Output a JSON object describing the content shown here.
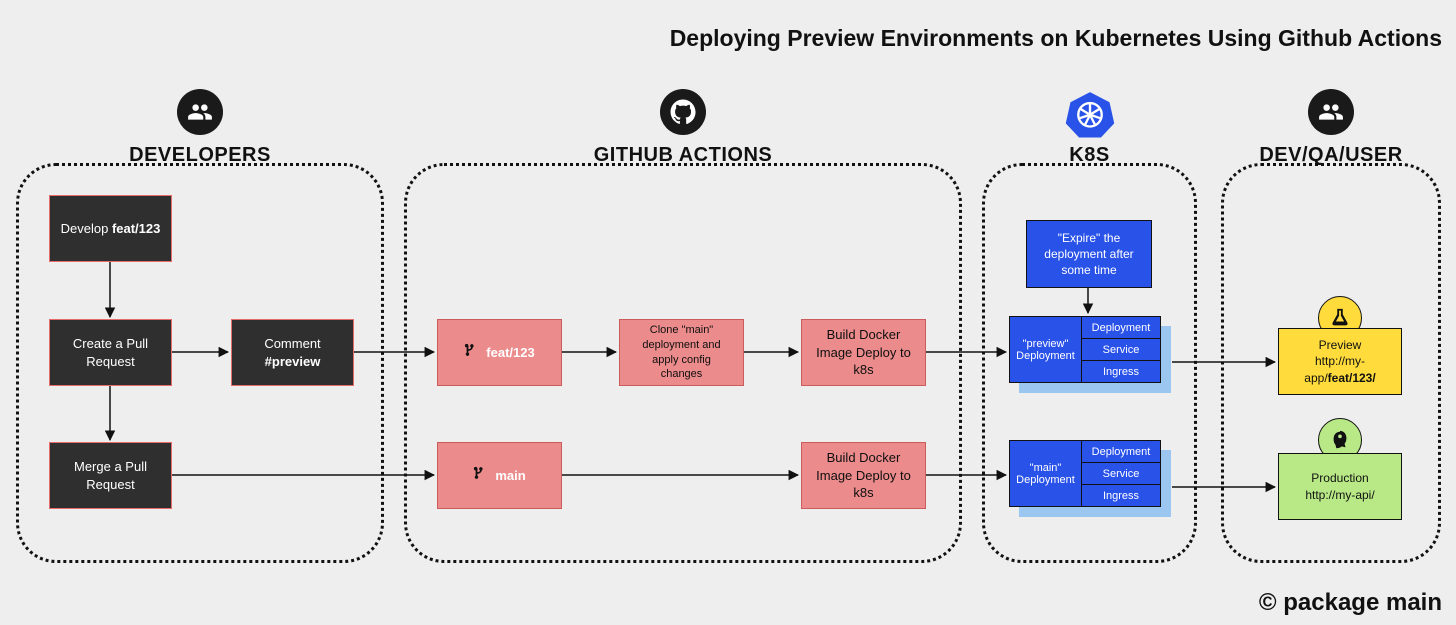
{
  "title": "Deploying Preview Environments on Kubernetes Using Github Actions",
  "copyright": "© package main",
  "groups": {
    "developers": {
      "label": "DEVELOPERS"
    },
    "github": {
      "label": "GITHUB ACTIONS"
    },
    "k8s": {
      "label": "K8S"
    },
    "user": {
      "label": "DEV/QA/USER"
    }
  },
  "dev": {
    "develop_pre": "Develop ",
    "develop_branch": "feat/123",
    "create_pr": "Create a Pull Request",
    "comment_pre": "Comment ",
    "comment_tag": "#preview",
    "merge_pr": "Merge a Pull Request"
  },
  "gha": {
    "branch_feat": "feat/123",
    "branch_main": "main",
    "clone": "Clone \"main\" deployment and apply config changes",
    "build_feat": "Build Docker Image Deploy to k8s",
    "build_main": "Build Docker Image Deploy to k8s"
  },
  "k8s": {
    "expire": "\"Expire\" the deployment after some time",
    "preview": {
      "label": "\"preview\" Deployment",
      "rows": [
        "Deployment",
        "Service",
        "Ingress"
      ]
    },
    "main": {
      "label": "\"main\" Deployment",
      "rows": [
        "Deployment",
        "Service",
        "Ingress"
      ]
    }
  },
  "env": {
    "preview": {
      "label": "Preview",
      "url_pre": "http://my-app/",
      "url_bold": "feat/123/"
    },
    "prod": {
      "label": "Production",
      "url": "http://my-api/"
    }
  }
}
